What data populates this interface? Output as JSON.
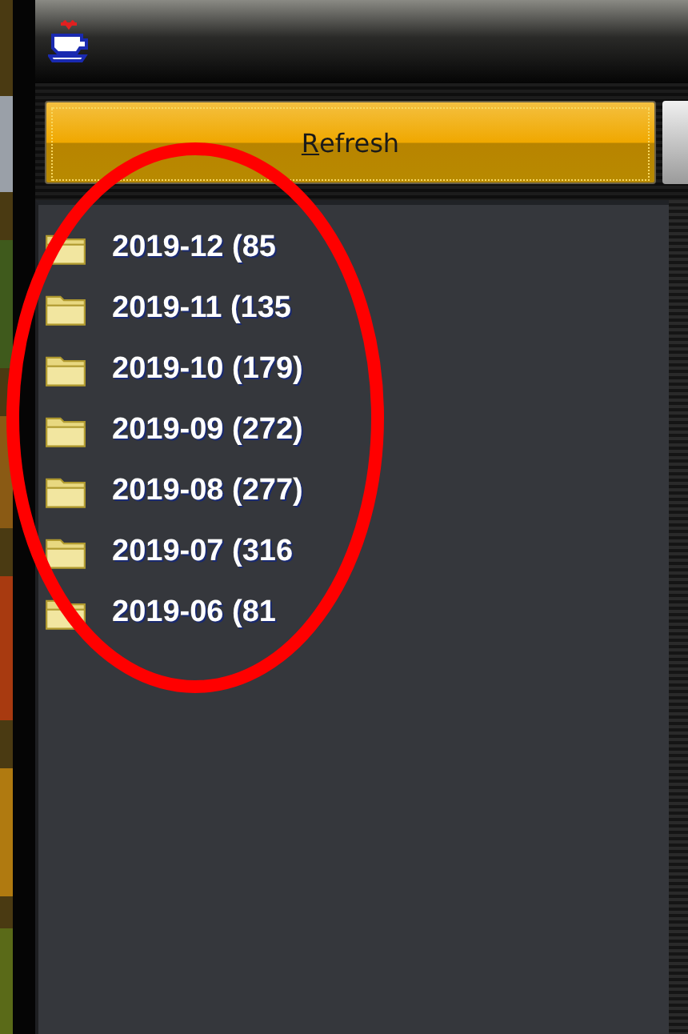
{
  "toolbar": {
    "refresh_button": {
      "label": "Refresh",
      "mnemonic": true
    }
  },
  "folders": [
    {
      "label": "2019-12 (85"
    },
    {
      "label": "2019-11 (135"
    },
    {
      "label": "2019-10 (179)"
    },
    {
      "label": "2019-09 (272)"
    },
    {
      "label": "2019-08 (277)"
    },
    {
      "label": "2019-07 (316"
    },
    {
      "label": "2019-06 (81"
    }
  ],
  "annotation": {
    "kind": "ellipse"
  }
}
